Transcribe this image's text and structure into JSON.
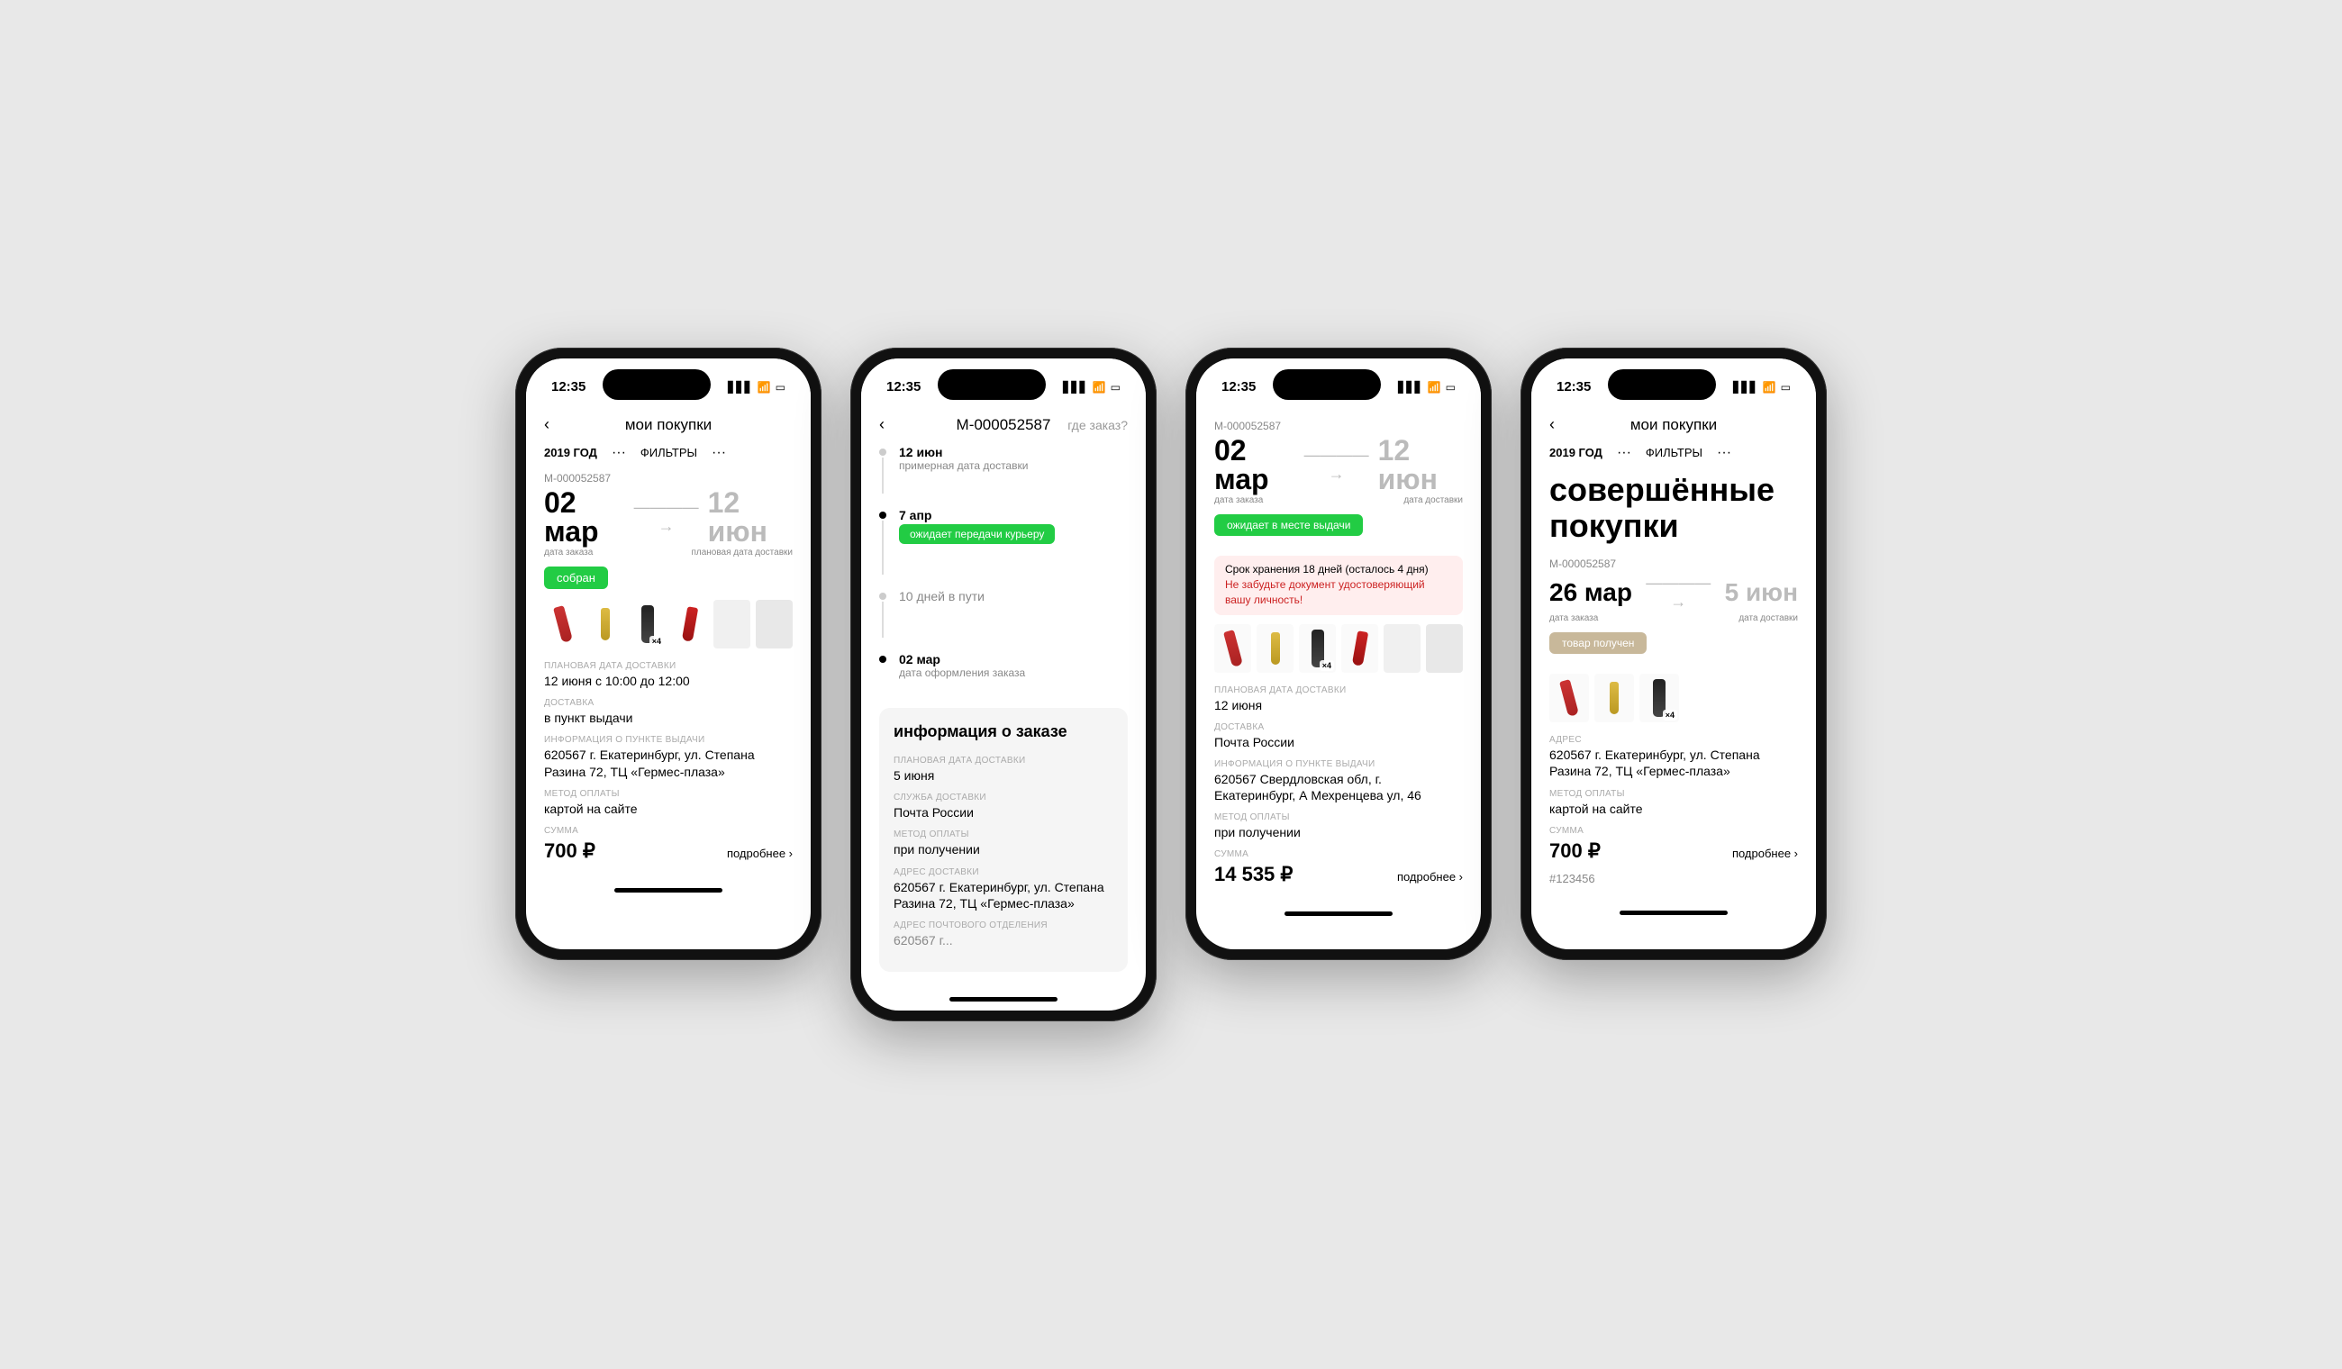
{
  "app": {
    "status_time": "12:35",
    "back_arrow": "‹",
    "more_dots": "···"
  },
  "phone1": {
    "nav_title": "мои покупки",
    "year_label": "2019 ГОД",
    "dots": "···",
    "filters_label": "ФИЛЬТРЫ",
    "filters_dots": "···",
    "order_id": "М-000052587",
    "date_from": "02 мар",
    "date_to": "12 июн",
    "date_from_label": "дата заказа",
    "date_to_label": "плановая дата доставки",
    "status": "собран",
    "info": [
      {
        "label": "ПЛАНОВАЯ ДАТА ДОСТАВКИ",
        "value": "12 июня с 10:00 до 12:00"
      },
      {
        "label": "ДОСТАВКА",
        "value": "в пункт выдачи"
      },
      {
        "label": "ИНФОРМАЦИЯ О ПУНКТЕ ВЫДАЧИ",
        "value": "620567 г. Екатеринбург, ул. Степана Разина 72,  ТЦ «Гермес-плаза»"
      },
      {
        "label": "МЕТОД ОПЛАТЫ",
        "value": "картой на сайте"
      },
      {
        "label": "СУММА",
        "value": "700 ₽"
      }
    ],
    "more_label": "подробнее ›"
  },
  "phone2": {
    "nav_title": "М-000052587",
    "nav_right": "где заказ?",
    "timeline": [
      {
        "date": "12 июн",
        "desc": "примерная дата доставки",
        "status": "future"
      },
      {
        "date": "7 апр",
        "desc": "ожидает передачи курьеру",
        "status": "current",
        "badge": true
      },
      {
        "desc": "10 дней в пути",
        "status": "info"
      },
      {
        "date": "02 мар",
        "desc": "дата оформления заказа",
        "status": "past"
      }
    ],
    "info_block_title": "информация о заказе",
    "info": [
      {
        "label": "ПЛАНОВАЯ ДАТА ДОСТАВКИ",
        "value": "5 июня"
      },
      {
        "label": "СЛУЖБА ДОСТАВКИ",
        "value": "Почта России"
      },
      {
        "label": "МЕТОД ОПЛАТЫ",
        "value": "при получении"
      },
      {
        "label": "АДРЕС ДОСТАВКИ",
        "value": "620567 г. Екатеринбург, ул. Степана Разина 72, ТЦ «Гермес-плаза»"
      },
      {
        "label": "АДРЕС ПОЧТОВОГО ОТДЕЛЕНИЯ",
        "value": "620567 г..."
      }
    ]
  },
  "phone3": {
    "order_id": "М-000052587",
    "date_from": "02 мар",
    "date_to": "12 июн",
    "date_from_label": "дата заказа",
    "date_to_label": "дата доставки",
    "status": "ожидает в месте выдачи",
    "alert_title": "Срок хранения 18 дней (осталось 4 дня)",
    "alert_text": "Не забудьте документ удостоверяющий вашу личность!",
    "info": [
      {
        "label": "ПЛАНОВАЯ ДАТА ДОСТАВКИ",
        "value": "12 июня"
      },
      {
        "label": "ДОСТАВКА",
        "value": "Почта России"
      },
      {
        "label": "ИНФОРМАЦИЯ О ПУНКТЕ ВЫДАЧИ",
        "value": "620567 Свердловская обл, г. Екатеринбург, А Мехренцева ул, 46"
      },
      {
        "label": "МЕТОД ОПЛАТЫ",
        "value": "при получении"
      },
      {
        "label": "СУММА",
        "value": "14 535 ₽"
      }
    ],
    "more_label": "подробнее ›"
  },
  "phone4": {
    "nav_title": "мои покупки",
    "year_label": "2019 ГОД",
    "dots": "···",
    "filters_label": "ФИЛЬТРЫ",
    "filters_dots": "···",
    "completed_title": "совершённые\nпокупки",
    "order_id": "М-000052587",
    "date_from": "26 мар",
    "date_to": "5 июн",
    "date_from_label": "дата заказа",
    "date_to_label": "дата доставки",
    "status": "товар получен",
    "info": [
      {
        "label": "АДРЕС",
        "value": "620567 г. Екатеринбург, ул. Степана Разина 72,  ТЦ «Гермес-плаза»"
      },
      {
        "label": "МЕТОД ОПЛАТЫ",
        "value": "картой на сайте"
      },
      {
        "label": "СУММА",
        "value": "700 ₽"
      }
    ],
    "more_label": "подробнее ›",
    "receipt": "#123456"
  }
}
